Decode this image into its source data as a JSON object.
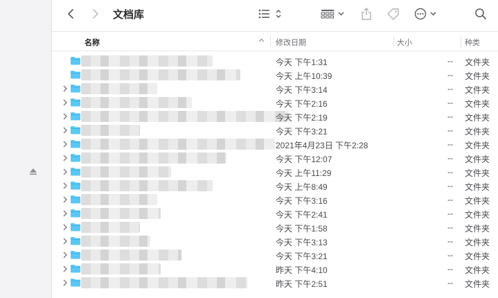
{
  "window": {
    "title": "文档库"
  },
  "columns": {
    "name": "名称",
    "date": "修改日期",
    "size": "大小",
    "kind": "种类"
  },
  "colors": {
    "folder": "#5ac8f5",
    "folder_dark": "#3fb4e6",
    "text": "#1d1d1f",
    "muted": "#6e6e73"
  },
  "rows": [
    {
      "date": "今天 下午1:31",
      "size": "--",
      "kind": "文件夹"
    },
    {
      "date": "今天 上午10:39",
      "size": "--",
      "kind": "文件夹"
    },
    {
      "date": "今天 下午3:14",
      "size": "--",
      "kind": "文件夹"
    },
    {
      "date": "今天 下午2:16",
      "size": "--",
      "kind": "文件夹"
    },
    {
      "date": "今天 下午2:19",
      "size": "--",
      "kind": "文件夹"
    },
    {
      "date": "今天 下午3:21",
      "size": "--",
      "kind": "文件夹"
    },
    {
      "date": "2021年4月23日 下午2:28",
      "size": "--",
      "kind": "文件夹"
    },
    {
      "date": "今天 下午12:07",
      "size": "--",
      "kind": "文件夹"
    },
    {
      "date": "今天 上午11:29",
      "size": "--",
      "kind": "文件夹"
    },
    {
      "date": "今天 上午8:49",
      "size": "--",
      "kind": "文件夹"
    },
    {
      "date": "今天 下午3:16",
      "size": "--",
      "kind": "文件夹"
    },
    {
      "date": "今天 下午2:41",
      "size": "--",
      "kind": "文件夹"
    },
    {
      "date": "今天 下午1:58",
      "size": "--",
      "kind": "文件夹"
    },
    {
      "date": "今天 下午3:13",
      "size": "--",
      "kind": "文件夹"
    },
    {
      "date": "今天 下午3:21",
      "size": "--",
      "kind": "文件夹"
    },
    {
      "date": "昨天 下午4:10",
      "size": "--",
      "kind": "文件夹"
    },
    {
      "date": "昨天 下午2:51",
      "size": "--",
      "kind": "文件夹"
    }
  ]
}
